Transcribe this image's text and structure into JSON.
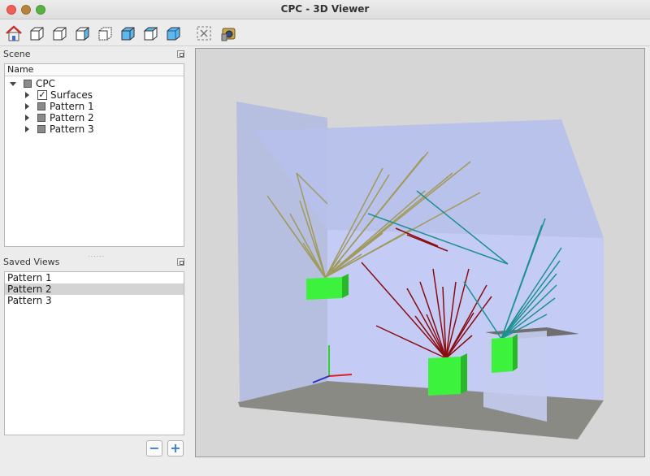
{
  "window": {
    "title": "CPC - 3D Viewer"
  },
  "toolbar": {
    "buttons": [
      {
        "icon": "home-icon"
      },
      {
        "icon": "view-cube-icon"
      },
      {
        "icon": "view-cube-front-icon"
      },
      {
        "icon": "view-cube-right-icon"
      },
      {
        "icon": "view-cube-left-icon"
      },
      {
        "icon": "view-cube-top-icon"
      },
      {
        "icon": "view-cube-back-icon"
      },
      {
        "icon": "view-cube-bottom-icon"
      },
      {
        "icon": "fit-selection-icon"
      },
      {
        "icon": "camera-icon"
      }
    ]
  },
  "scene_panel": {
    "title": "Scene",
    "column": "Name",
    "root": "CPC",
    "items": [
      {
        "label": "Surfaces",
        "checked": true
      },
      {
        "label": "Pattern 1"
      },
      {
        "label": "Pattern 2"
      },
      {
        "label": "Pattern 3"
      }
    ]
  },
  "saved_views": {
    "title": "Saved Views",
    "items": [
      "Pattern 1",
      "Pattern 2",
      "Pattern 3"
    ],
    "selected": "Pattern 2",
    "remove_label": "−",
    "add_label": "+"
  },
  "scene_colors": {
    "background": "#d6d6d6",
    "wall": "#b4c0ee",
    "floor": "#8a8a84",
    "source": "#3cf23c",
    "pattern_1": "#a09a5c",
    "pattern_2": "#8a0c10",
    "pattern_3": "#1e9090"
  }
}
